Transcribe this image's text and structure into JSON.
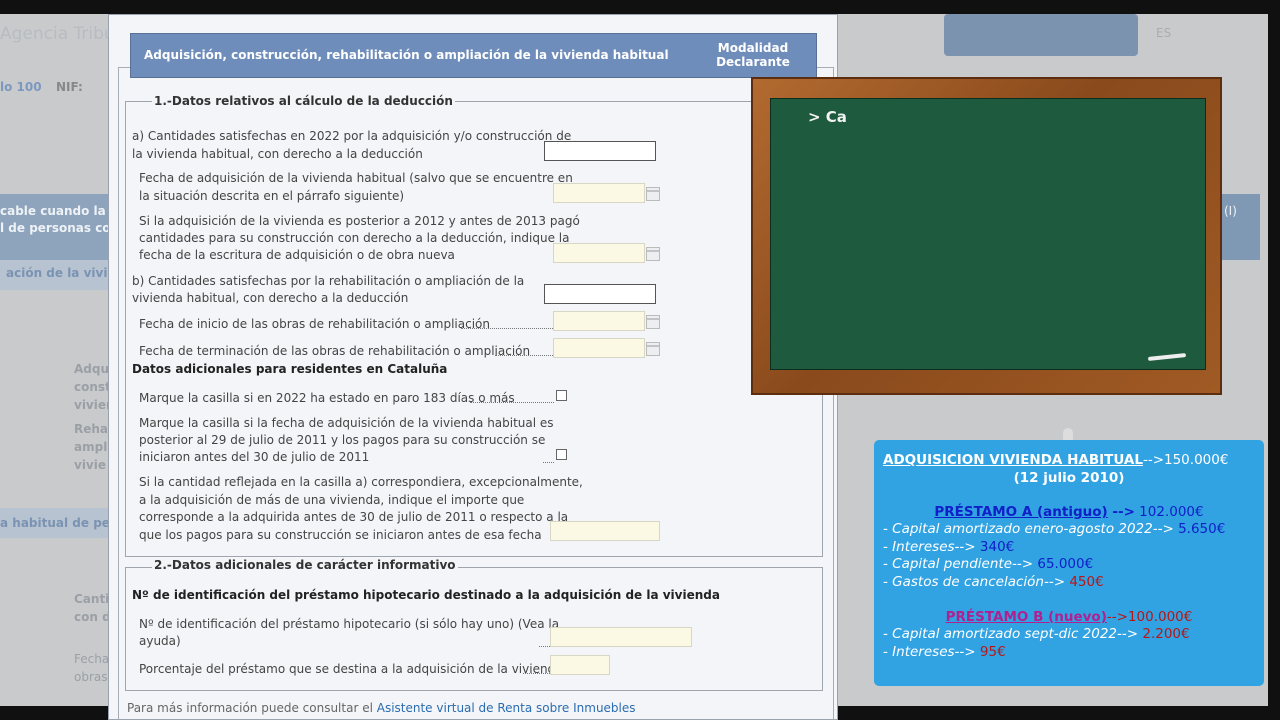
{
  "background": {
    "agency": "Agencia Tribut",
    "modelo": "lo 100",
    "nif_label": "NIF:",
    "lang": "ES",
    "left_fragments": [
      "cable cuando la ad",
      "l de personas con",
      "ación de la viviend",
      "Adqui",
      "constr",
      "vivien",
      "Rehab",
      "ampli",
      "vivie",
      "a habitual de perso",
      "Cantid",
      "con de",
      "Fecha",
      "obras"
    ],
    "right_fragment": "(I)"
  },
  "modal": {
    "title": "Adquisición, construcción, rehabilitación o ampliación de la vivienda habitual",
    "column": [
      "Modalidad",
      "Declarante"
    ],
    "section1": {
      "legend": "1.-Datos relativos al cálculo de la deducción",
      "a_label_1": "a) Cantidades satisfechas en 2022 por la adquisición y/o construcción de",
      "a_label_2": "la vivienda habitual, con derecho a la deducción",
      "fecha_adq_1": "Fecha de adquisición de la vivienda habitual (salvo que se encuentre en",
      "fecha_adq_2": "la situación descrita en el párrafo siguiente)",
      "posterior_1": "Si la adquisición de la vivienda es posterior a 2012 y antes de 2013 pagó",
      "posterior_2": "cantidades para su construcción con derecho a la deducción, indique la",
      "posterior_3": "fecha de la escritura de adquisición o de obra nueva",
      "b_label_1": "b) Cantidades satisfechas por la rehabilitación o ampliación de la",
      "b_label_2": "vivienda habitual, con derecho a la deducción",
      "fecha_inicio": "Fecha de inicio de las obras de rehabilitación o ampliación",
      "fecha_fin": "Fecha de terminación de las obras de rehabilitación o ampliación",
      "cataluna_heading": "Datos adicionales para residentes en Cataluña",
      "paro": "Marque la casilla si en 2022 ha estado en paro 183 días o más",
      "fecha_julio_1": "Marque la casilla si la fecha de adquisición de la vivienda habitual es",
      "fecha_julio_2": "posterior al 29 de julio de 2011 y los pagos para su construcción se",
      "fecha_julio_3": "iniciaron antes del 30 de julio de 2011",
      "excep_1": "Si la cantidad reflejada en la casilla a) correspondiera, excepcionalmente,",
      "excep_2": "a la adquisición de más de una vivienda, indique el importe que",
      "excep_3": "corresponde a la adquirida antes de 30 de julio de 2011 o respecto a la",
      "excep_4": "que los pagos para su construcción se iniciaron antes de esa fecha"
    },
    "section2": {
      "legend": "2.-Datos adicionales de carácter informativo",
      "heading": "Nº de identificación del préstamo hipotecario destinado a la adquisición de la vivienda",
      "id_1": "Nº de identificación del préstamo hipotecario (si sólo hay uno) (Vea la",
      "id_2": "ayuda)",
      "porcentaje": "Porcentaje del préstamo que se destina a la adquisición de la vivienda"
    },
    "footer_prefix": "Para más información puede consultar el ",
    "footer_link": "Asistente virtual de Renta sobre Inmuebles"
  },
  "board": {
    "text": "> Ca"
  },
  "card": {
    "title": "ADQUISICION VIVIENDA HABITUAL",
    "title_value": "-->150.000€",
    "date": "(12 julio 2010)",
    "prestamo_a": "PRÉSTAMO A (antiguo)",
    "prestamo_a_arrow": " -->",
    "prestamo_a_value": " 102.000€",
    "a_rows": [
      {
        "label": "- Capital amortizado enero-agosto 2022-->",
        "value": " 5.650€"
      },
      {
        "label": "- Intereses-->",
        "value": " 340€"
      },
      {
        "label": "- Capital pendiente-->",
        "value": " 65.000€"
      },
      {
        "label": "- Gastos de cancelación-->",
        "value": " 450€"
      }
    ],
    "prestamo_b": "PRÉSTAMO B (nuevo)",
    "prestamo_b_value": "-->100.000€",
    "b_rows": [
      {
        "label": "- Capital amortizado sept-dic 2022-->",
        "value": " 2.200€"
      },
      {
        "label": "- Intereses-->",
        "value": " 95€"
      }
    ]
  }
}
